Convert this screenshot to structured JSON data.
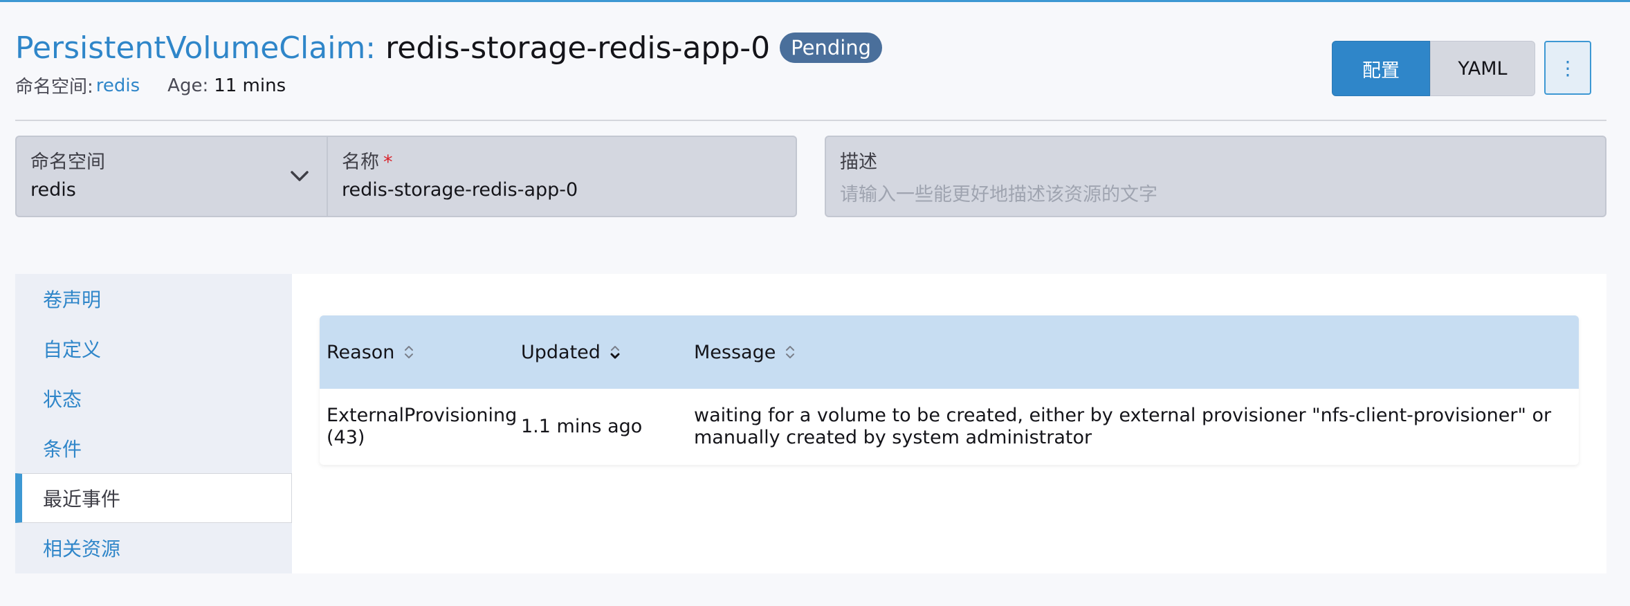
{
  "header": {
    "kind": "PersistentVolumeClaim:",
    "name": "redis-storage-redis-app-0",
    "status": "Pending",
    "namespace_label": "命名空间:",
    "namespace_value": "redis",
    "age_label": "Age:",
    "age_value": "11 mins"
  },
  "actions": {
    "config_label": "配置",
    "yaml_label": "YAML",
    "more_icon": "⋮"
  },
  "form": {
    "namespace": {
      "label": "命名空间",
      "value": "redis"
    },
    "name": {
      "label": "名称",
      "required_mark": "*",
      "value": "redis-storage-redis-app-0"
    },
    "description": {
      "label": "描述",
      "placeholder": "请输入一些能更好地描述该资源的文字"
    }
  },
  "sidenav": {
    "items": [
      {
        "label": "卷声明",
        "active": false
      },
      {
        "label": "自定义",
        "active": false
      },
      {
        "label": "状态",
        "active": false
      },
      {
        "label": "条件",
        "active": false
      },
      {
        "label": "最近事件",
        "active": true
      },
      {
        "label": "相关资源",
        "active": false
      }
    ]
  },
  "events_table": {
    "columns": [
      "Reason",
      "Updated",
      "Message"
    ],
    "rows": [
      {
        "reason": "ExternalProvisioning (43)",
        "updated": "1.1 mins ago",
        "message": "waiting for a volume to be created, either by external provisioner \"nfs-client-provisioner\" or manually created by system administrator"
      }
    ]
  },
  "colors": {
    "accent": "#2f86c9",
    "badge": "#4a6f9b",
    "table_header": "#c7ddf2",
    "required": "#d9232c"
  }
}
